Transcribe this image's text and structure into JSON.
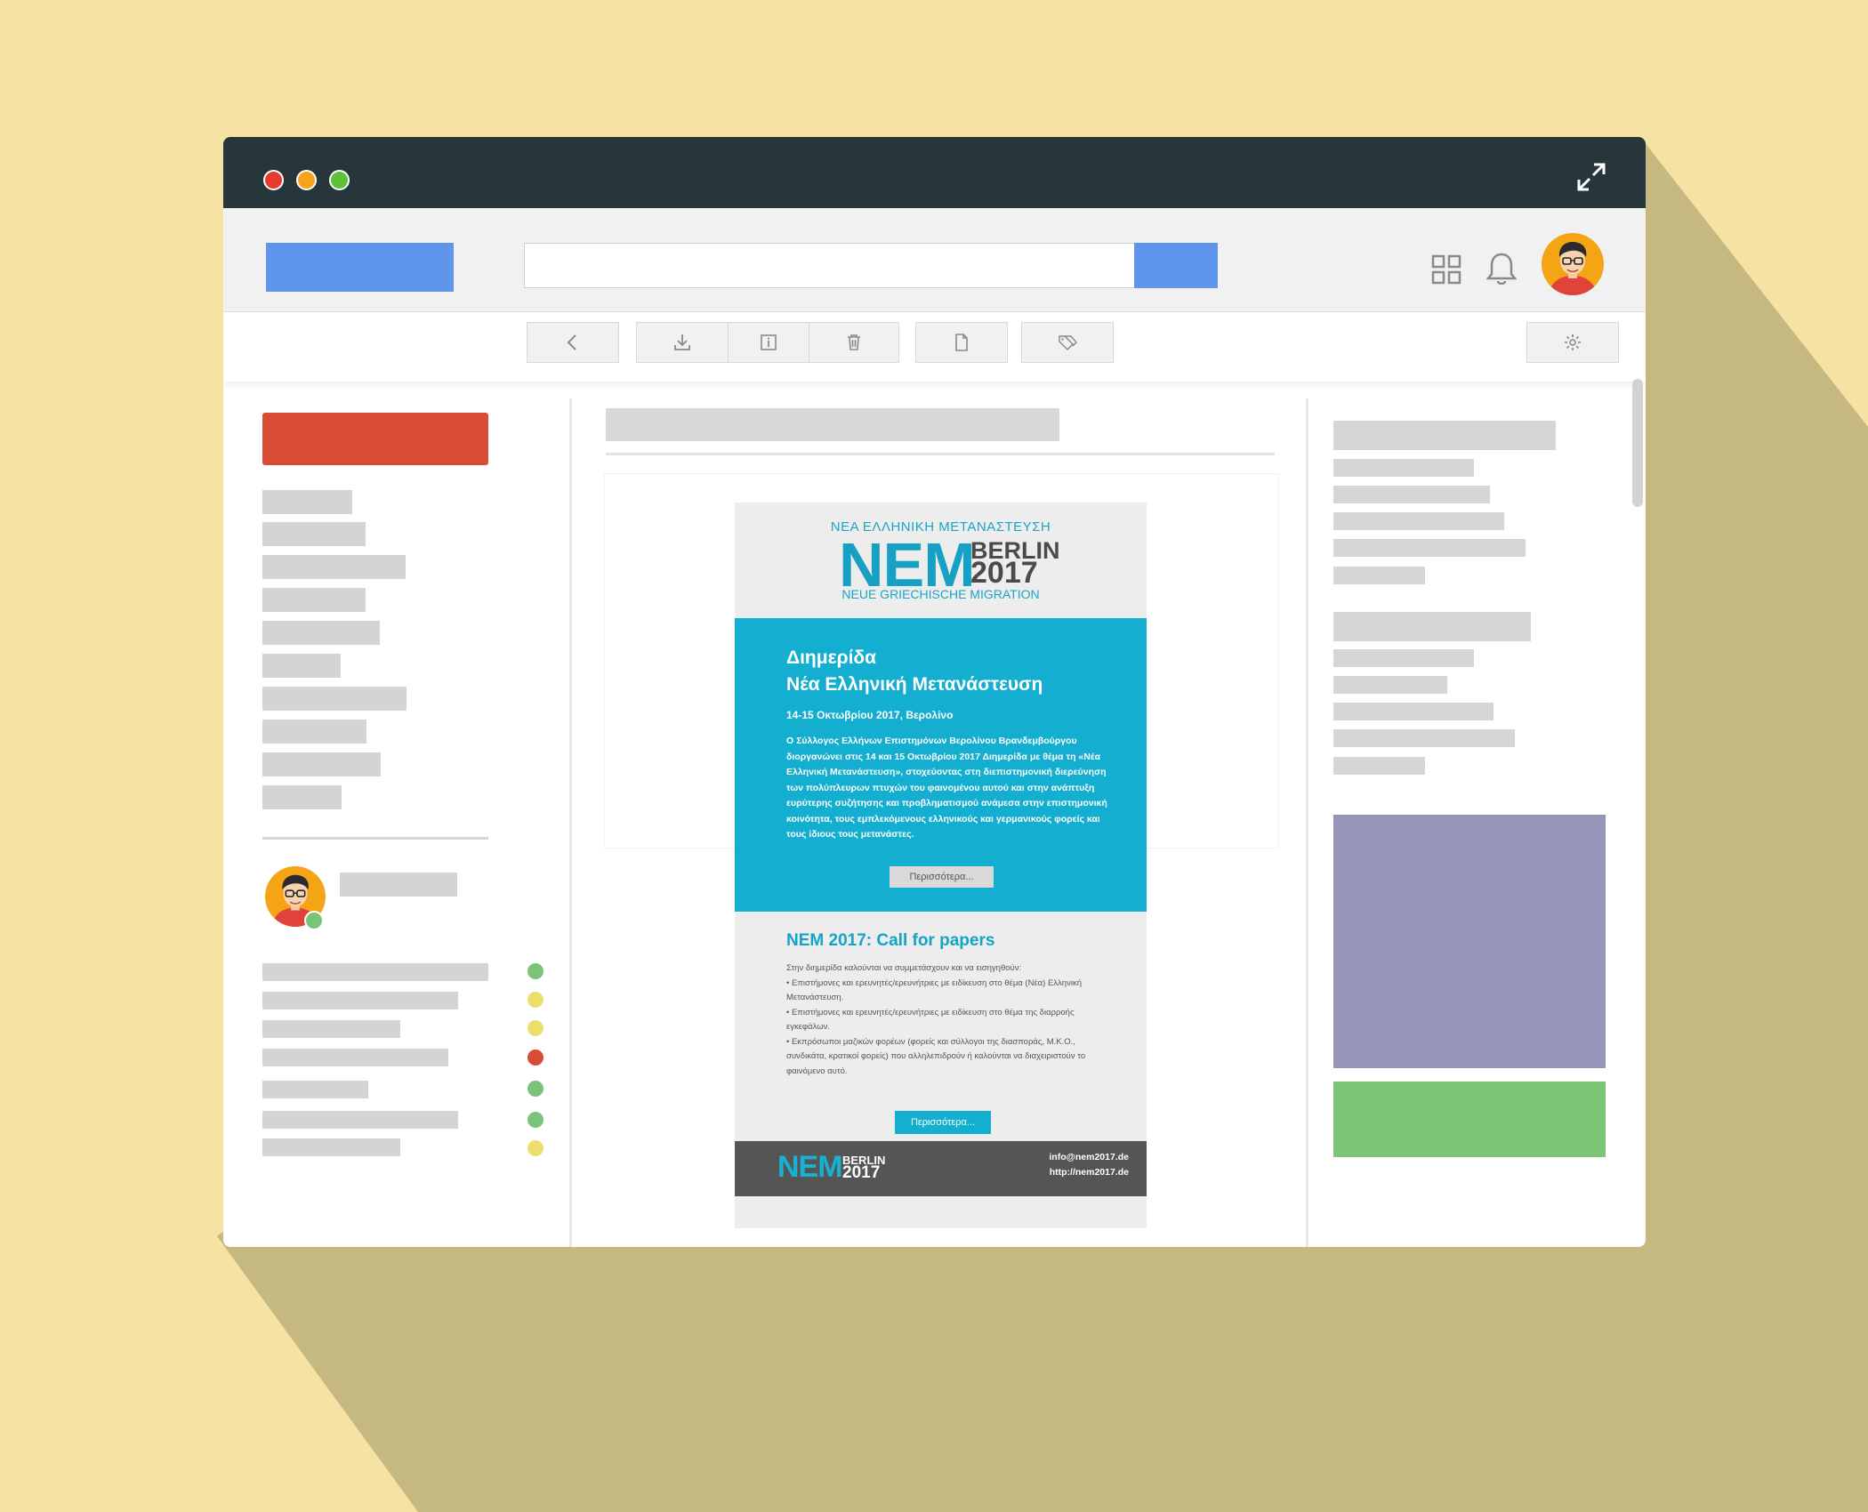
{
  "colors": {
    "background": "#f6e3a3",
    "shadow": "#c6b881",
    "titlebar": "#26363b",
    "accent_blue": "#5f96ec",
    "compose_red": "#da4b36",
    "newsletter_cyan": "#13aed0",
    "ad_purple": "#9596b7",
    "ad_green": "#7dc576"
  },
  "window": {
    "traffic_lights": [
      "#e63a2e",
      "#f6a21c",
      "#5dc23a"
    ],
    "expand_icon": "expand-icon"
  },
  "topbar": {
    "search_value": "",
    "icons": [
      "apps-grid-icon",
      "bell-icon",
      "avatar"
    ]
  },
  "toolbar": {
    "buttons": [
      "back-icon",
      "download-icon",
      "info-icon",
      "trash-icon",
      "document-icon",
      "tag-icon",
      "gear-icon"
    ]
  },
  "sidebar": {
    "status_dots": [
      "#7ac47a",
      "#ecde6b",
      "#ecde6b",
      "#da4b36",
      "#7ac47a",
      "#7ac47a",
      "#ecde6b"
    ]
  },
  "newsletter": {
    "header": {
      "kicker": "ΝΕΑ ΕΛΛΗΝΙΚΗ ΜΕΤΑΝΑΣΤΕΥΣΗ",
      "logo_nem": "NEM",
      "logo_berlin": "BERLIN",
      "logo_year": "2017",
      "subtitle": "NEUE GRIECHISCHE MIGRATION"
    },
    "hero": {
      "title_line1": "Διημερίδα",
      "title_line2": "Νέα Ελληνική Μετανάστευση",
      "date": "14-15 Οκτωβρίου 2017, Βερολίνο",
      "body": "Ο Σύλλογος Ελλήνων Επιστημόνων Βερολίνου Βρανδεμβούργου διοργανώνει στις 14 και 15 Οκτωβρίου 2017 Διημερίδα με θέμα τη «Νέα Ελληνική Μετανάστευση», στοχεύοντας στη διεπιστημονική διερεύνηση των πολύπλευρων πτυχών του φαινομένου αυτού και στην ανάπτυξη ευρύτερης συζήτησης και προβληματισμού ανάμεσα στην επιστημονική κοινότητα, τους εμπλεκόμενους ελληνικούς και γερμανικούς φορείς και τους ίδιους τους μετανάστες.",
      "button": "Περισσότερα..."
    },
    "cfp": {
      "title": "NEM 2017: Call for papers",
      "intro": "Στην διημερίδα καλούνται να συμμετάσχουν και να εισηγηθούν:",
      "items": [
        "• Επιστήμονες και ερευνητές/ερευνήτριες με ειδίκευση στο θέμα (Νέα) Ελληνική Μετανάστευση.",
        "• Επιστήμονες και ερευνητές/ερευνήτριες με ειδίκευση στο θέμα της διαρροής εγκεφάλων.",
        "• Εκπρόσωποι μαζικών φορέων (φορείς και σύλλογοι της διασποράς, Μ.Κ.Ο., συνδικάτα, κρατικοί φορείς) που αλληλεπιδρούν ή καλούνται να διαχειριστούν το φαινόμενο αυτό."
      ],
      "button": "Περισσότερα..."
    },
    "footer": {
      "logo_nem": "NEM",
      "logo_berlin": "BERLIN",
      "logo_year": "2017",
      "email": "info@nem2017.de",
      "url": "http://nem2017.de"
    }
  }
}
